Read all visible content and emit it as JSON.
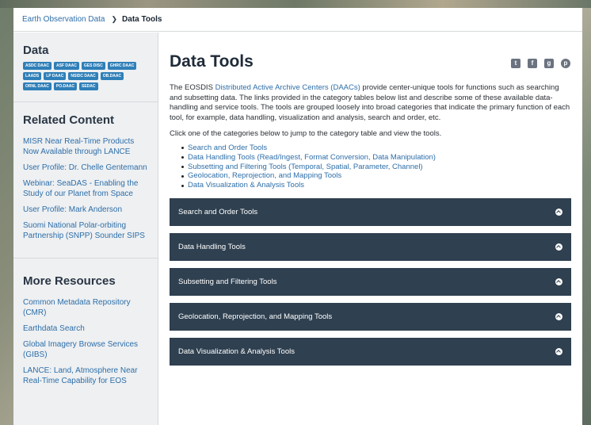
{
  "breadcrumb": {
    "parent": "Earth Observation Data",
    "separator": "❯",
    "current": "Data Tools"
  },
  "sidebar": {
    "data_heading": "Data",
    "daacs": [
      "ASDC DAAC",
      "ASF DAAC",
      "GES DISC",
      "GHRC DAAC",
      "LAADS",
      "LP DAAC",
      "NSIDC DAAC",
      "OB.DAAC",
      "ORNL DAAC",
      "PO.DAAC",
      "SEDAC"
    ],
    "related_heading": "Related Content",
    "related": [
      "MISR Near Real-Time Products Now Available through LANCE",
      "User Profile: Dr. Chelle Gentemann",
      "Webinar: SeaDAS - Enabling the Study of our Planet from Space",
      "User Profile: Mark Anderson",
      "Suomi National Polar-orbiting Partnership (SNPP) Sounder SIPS"
    ],
    "more_heading": "More Resources",
    "more": [
      "Common Metadata Repository (CMR)",
      "Earthdata Search",
      "Global Imagery Browse Services (GIBS)",
      "LANCE: Land, Atmosphere Near Real-Time Capability for EOS"
    ]
  },
  "main": {
    "title": "Data Tools",
    "social_icons": [
      "twitter-icon",
      "facebook-icon",
      "google-plus-icon",
      "pinterest-icon"
    ],
    "intro_before": "The EOSDIS ",
    "intro_link": "Distributed Active Archive Centers (DAACs)",
    "intro_after": " provide center-unique tools for functions such as searching and subsetting data. The links provided in the category tables below list and describe some of these available data-handling and service tools. The tools are grouped loosely into broad categories that indicate the primary function of each tool, for example, data handling, visualization and analysis, search and order, etc.",
    "instruction": "Click one of the categories below to jump to the category table and view the tools.",
    "tool_links": [
      "Search and Order Tools",
      "Data Handling Tools (Read/Ingest, Format Conversion, Data Manipulation)",
      "Subsetting and Filtering Tools (Temporal, Spatial, Parameter, Channel)",
      "Geolocation, Reprojection, and Mapping Tools",
      "Data Visualization & Analysis Tools"
    ],
    "accordions": [
      "Search and Order Tools",
      "Data Handling Tools",
      "Subsetting and Filtering Tools",
      "Geolocation, Reprojection, and Mapping Tools",
      "Data Visualization & Analysis Tools"
    ]
  },
  "colors": {
    "link": "#2d6ea8",
    "accordion_bg": "#2f4050",
    "daac_badge": "#2f7fb8",
    "sidebar_bg": "#eef0f2"
  }
}
